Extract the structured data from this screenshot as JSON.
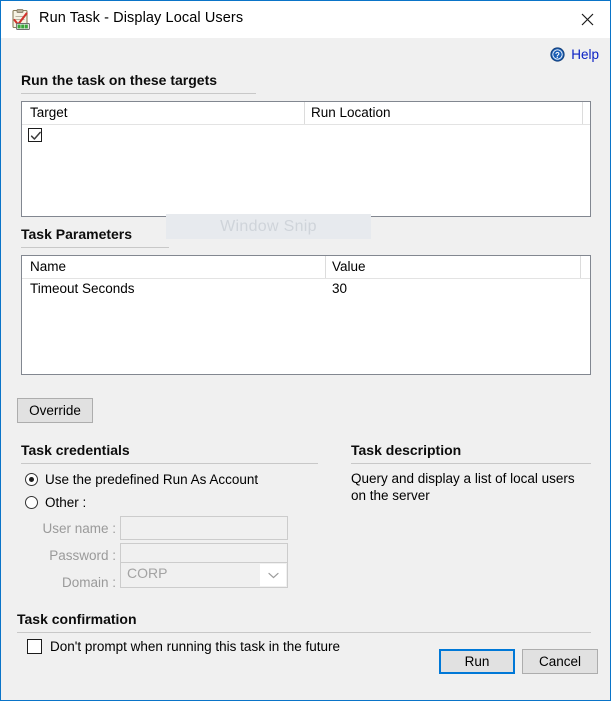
{
  "window": {
    "title": "Run Task - Display Local Users",
    "icon": "run-task-clipboard-icon",
    "close_label": "×",
    "border_color": "#0a74c8"
  },
  "help": {
    "label": "Help",
    "icon": "help-question-icon",
    "color": "#0b21c4"
  },
  "targets_section": {
    "header": "Run the task on these targets",
    "columns": [
      "Target",
      "Run Location"
    ],
    "rows": [
      {
        "target": "",
        "run_location": "",
        "checked": true
      }
    ]
  },
  "parameters_section": {
    "header": "Task Parameters",
    "columns": [
      "Name",
      "Value"
    ],
    "rows": [
      {
        "name": "Timeout Seconds",
        "value": "30"
      }
    ]
  },
  "overlay": {
    "ghost_text": "Window Snip"
  },
  "override_button": {
    "label": "Override"
  },
  "credentials_section": {
    "header": "Task credentials",
    "options": [
      {
        "label": "Use the predefined Run As Account",
        "selected": true
      },
      {
        "label": "Other :",
        "selected": false
      }
    ],
    "fields": [
      {
        "label": "User name :",
        "value": "",
        "type": "text",
        "disabled": true
      },
      {
        "label": "Password :",
        "value": "",
        "type": "password",
        "disabled": true
      },
      {
        "label": "Domain :",
        "value": "CORP",
        "type": "combo",
        "disabled": true
      }
    ]
  },
  "description_section": {
    "header": "Task description",
    "text": "Query and display a list of local users on the server"
  },
  "confirmation_section": {
    "header": "Task confirmation",
    "checkbox_label": "Don't prompt when running this task in the future",
    "checked": false
  },
  "footer": {
    "run_label": "Run",
    "cancel_label": "Cancel",
    "default_button": "Run"
  }
}
